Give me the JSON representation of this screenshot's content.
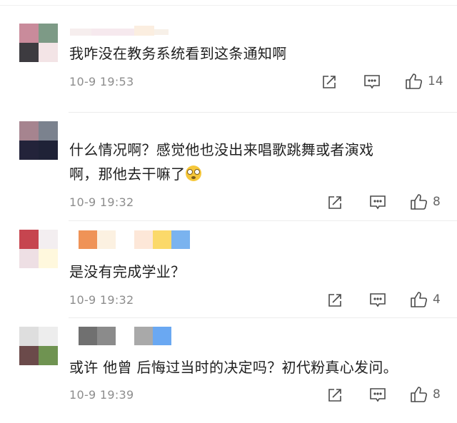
{
  "comments": [
    {
      "text": "我咋没在教务系统看到这条通知啊",
      "time": "10-9 19:53",
      "likes": "14",
      "avatar_colors": [
        "#c98b9b",
        "#7d9a86",
        "#3d3b40",
        "#f3e4e6"
      ],
      "nick_colors": [
        "#f6eeee",
        "#f6e9ee",
        "#fbeee0",
        "#f7f0e8"
      ]
    },
    {
      "text": "什么情况啊？感觉他也没出来唱歌跳舞或者演戏\n啊，那他去干嘛了",
      "emoji": "flushed-face-emoji",
      "time": "10-9 19:32",
      "likes": "8",
      "avatar_colors": [
        "#a6848f",
        "#7b828e",
        "#23233a",
        "#1f2237"
      ],
      "nick_colors": []
    },
    {
      "text": "是没有完成学业？",
      "time": "10-9 19:32",
      "likes": "4",
      "avatar_colors": [
        "#c6454f",
        "#f3eef0",
        "#eedfe4",
        "#fff8dd"
      ],
      "nick_colors": [
        "#ef9357",
        "#fcf1e1",
        "#fde7d8",
        "#fbd96a",
        "#7ab3ef"
      ]
    },
    {
      "text": "或许 他曾 后悔过当时的决定吗？初代粉真心发问。",
      "time": "10-9 19:39",
      "likes": "8",
      "avatar_colors": [
        "#dedede",
        "#ededed",
        "#6b4a4a",
        "#6f9351"
      ],
      "nick_colors": [
        "#707070",
        "#8b8b8b",
        "#a9a9a9",
        "#6aa8f2"
      ]
    }
  ],
  "icons": {
    "repost": "repost-icon",
    "reply": "comment-icon",
    "like": "thumbs-up-icon"
  }
}
